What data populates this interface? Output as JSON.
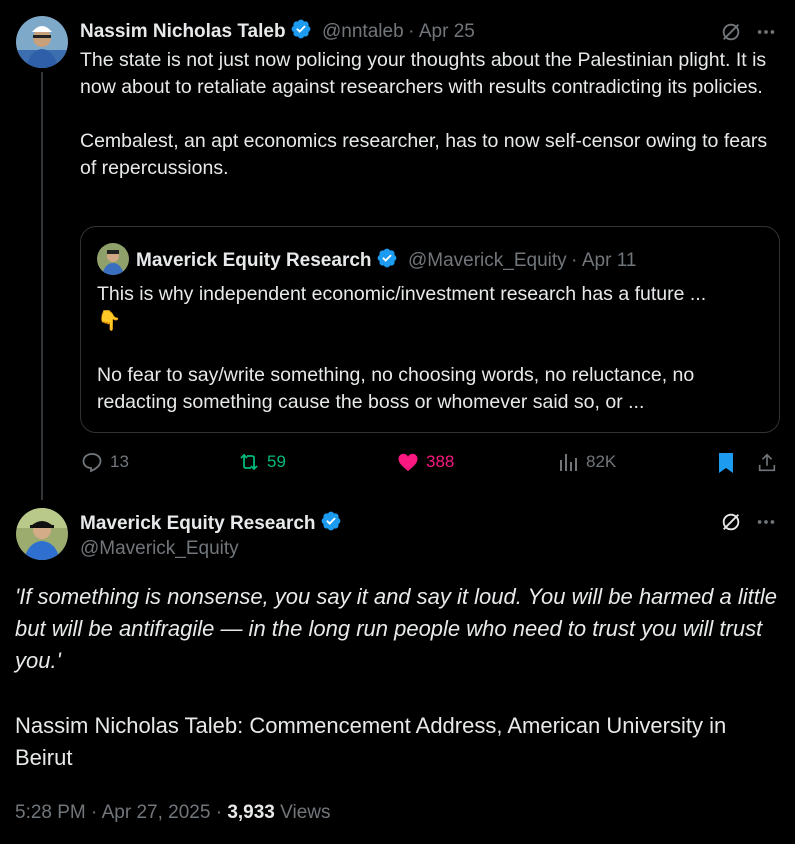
{
  "parent_tweet": {
    "author_name": "Nassim Nicholas Taleb",
    "handle": "@nntaleb",
    "separator": "·",
    "date": "Apr 25",
    "text_p1": "The state is not just now policing your thoughts about the Palestinian plight. It is now about to retaliate against researchers with results contradicting its policies.",
    "text_p2": "Cembalest, an apt economics researcher, has to now self-censor owing to fears of repercussions.",
    "quote": {
      "author_name": "Maverick Equity Research",
      "handle": "@Maverick_Equity",
      "separator": "·",
      "date": "Apr 11",
      "text_p1": "This is why independent economic/investment research has a future ...",
      "emoji": "👇",
      "text_p2": "No fear to say/write something, no choosing words, no reluctance, no redacting something cause the boss or whomever said so, or ..."
    },
    "actions": {
      "replies": "13",
      "reposts": "59",
      "likes": "388",
      "views": "82K"
    }
  },
  "main_tweet": {
    "author_name": "Maverick Equity Research",
    "handle": "@Maverick_Equity",
    "quote_text": "'If something is nonsense, you say it and say it loud. You will be harmed a little but will be antifragile — in the long run people who need to trust you will trust you.'",
    "attribution": "Nassim Nicholas Taleb: Commencement Address, American University in Beirut",
    "time": "5:28 PM",
    "separator": "·",
    "date": "Apr 27, 2025",
    "separator2": "·",
    "views_count": "3,933",
    "views_label": "Views"
  },
  "colors": {
    "background": "#000000",
    "text": "#e7e9ea",
    "muted": "#71767b",
    "verified": "#1d9bf0",
    "repost": "#00ba7c",
    "like": "#f91880",
    "bookmark": "#1d9bf0"
  }
}
